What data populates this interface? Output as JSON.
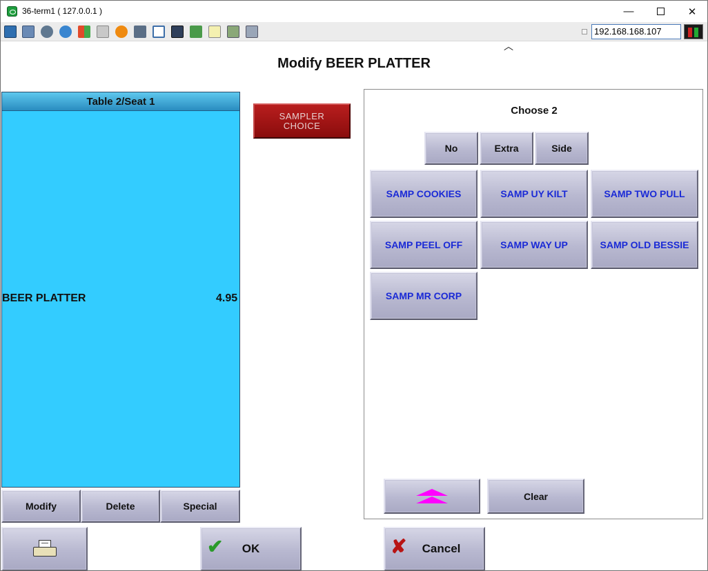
{
  "window": {
    "title": "36-term1 ( 127.0.0.1 )",
    "controls": {
      "minimize": "—",
      "close": "✕"
    }
  },
  "toolbar": {
    "icons": [
      "monitor-icon",
      "windows-icon",
      "tools-icon",
      "refresh-icon",
      "windows-logo-icon",
      "keyboard-icon",
      "alert-icon",
      "network-icon",
      "fullscreen-icon",
      "display-icon",
      "transfer-icon",
      "notepad-icon",
      "map-icon",
      "chat-icon"
    ],
    "ip_address": "192.168.168.107"
  },
  "page": {
    "title": "Modify BEER PLATTER"
  },
  "seat_panel": {
    "header": "Table 2/Seat 1",
    "items": [
      {
        "name": "BEER PLATTER",
        "price": "4.95"
      }
    ],
    "buttons": {
      "modify": "Modify",
      "delete": "Delete",
      "special": "Special"
    }
  },
  "sampler_choice": "SAMPLER\nCHOICE",
  "choice_panel": {
    "title": "Choose 2",
    "modifiers": {
      "no": "No",
      "extra": "Extra",
      "side": "Side"
    },
    "options": [
      "SAMP COOKIES",
      "SAMP UY KILT",
      "SAMP TWO PULL",
      "SAMP PEEL OFF",
      "SAMP WAY UP",
      "SAMP OLD BESSIE",
      "SAMP MR CORP"
    ],
    "clear": "Clear"
  },
  "footer": {
    "ok": "OK",
    "cancel": "Cancel"
  },
  "colors": {
    "seat_panel_bg": "#33ccff",
    "sampler_bg": "#a01818",
    "option_text": "#1a2ad6",
    "arrow": "#ff00ff"
  }
}
